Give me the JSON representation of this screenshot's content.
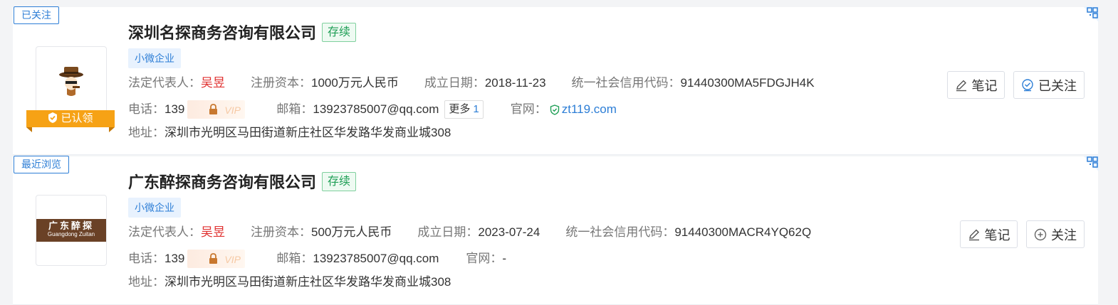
{
  "companies": [
    {
      "corner_tag": "已关注",
      "name": "深圳名探商务咨询有限公司",
      "status": "存续",
      "badge": "小微企业",
      "legal_rep_label": "法定代表人：",
      "legal_rep": "吴昱",
      "capital_label": "注册资本：",
      "capital": "1000万元人民币",
      "founded_label": "成立日期：",
      "founded": "2018-11-23",
      "credit_label": "统一社会信用代码：",
      "credit_code": "91440300MA5FDGJH4K",
      "phone_label": "电话：",
      "phone": "139",
      "email_label": "邮箱：",
      "email": "13923785007@qq.com",
      "more_label": "更多",
      "more_count": "1",
      "website_label": "官网：",
      "website": "zt119.com",
      "address_label": "地址：",
      "address": "深圳市光明区马田街道新庄社区华发路华发商业城308",
      "claimed_label": "已认领",
      "note_button": "笔记",
      "follow_button": "已关注"
    },
    {
      "corner_tag": "最近浏览",
      "name": "广东醉探商务咨询有限公司",
      "status": "存续",
      "badge": "小微企业",
      "logo_text": "广东醉探",
      "logo_subtext": "Guangdong Zuitan",
      "legal_rep_label": "法定代表人：",
      "legal_rep": "吴昱",
      "capital_label": "注册资本：",
      "capital": "500万元人民币",
      "founded_label": "成立日期：",
      "founded": "2023-07-24",
      "credit_label": "统一社会信用代码：",
      "credit_code": "91440300MACR4YQ62Q",
      "phone_label": "电话：",
      "phone": "139",
      "email_label": "邮箱：",
      "email": "13923785007@qq.com",
      "website_label": "官网：",
      "website": "-",
      "address_label": "地址：",
      "address": "深圳市光明区马田街道新庄社区华发路华发商业城308",
      "note_button": "笔记",
      "follow_button": "关注"
    }
  ],
  "vip_mark": "VIP",
  "colors": {
    "accent": "#2d7ed6",
    "status_green": "#1e9e55",
    "legal_red": "#e0302f",
    "claim_orange": "#f6a215"
  }
}
